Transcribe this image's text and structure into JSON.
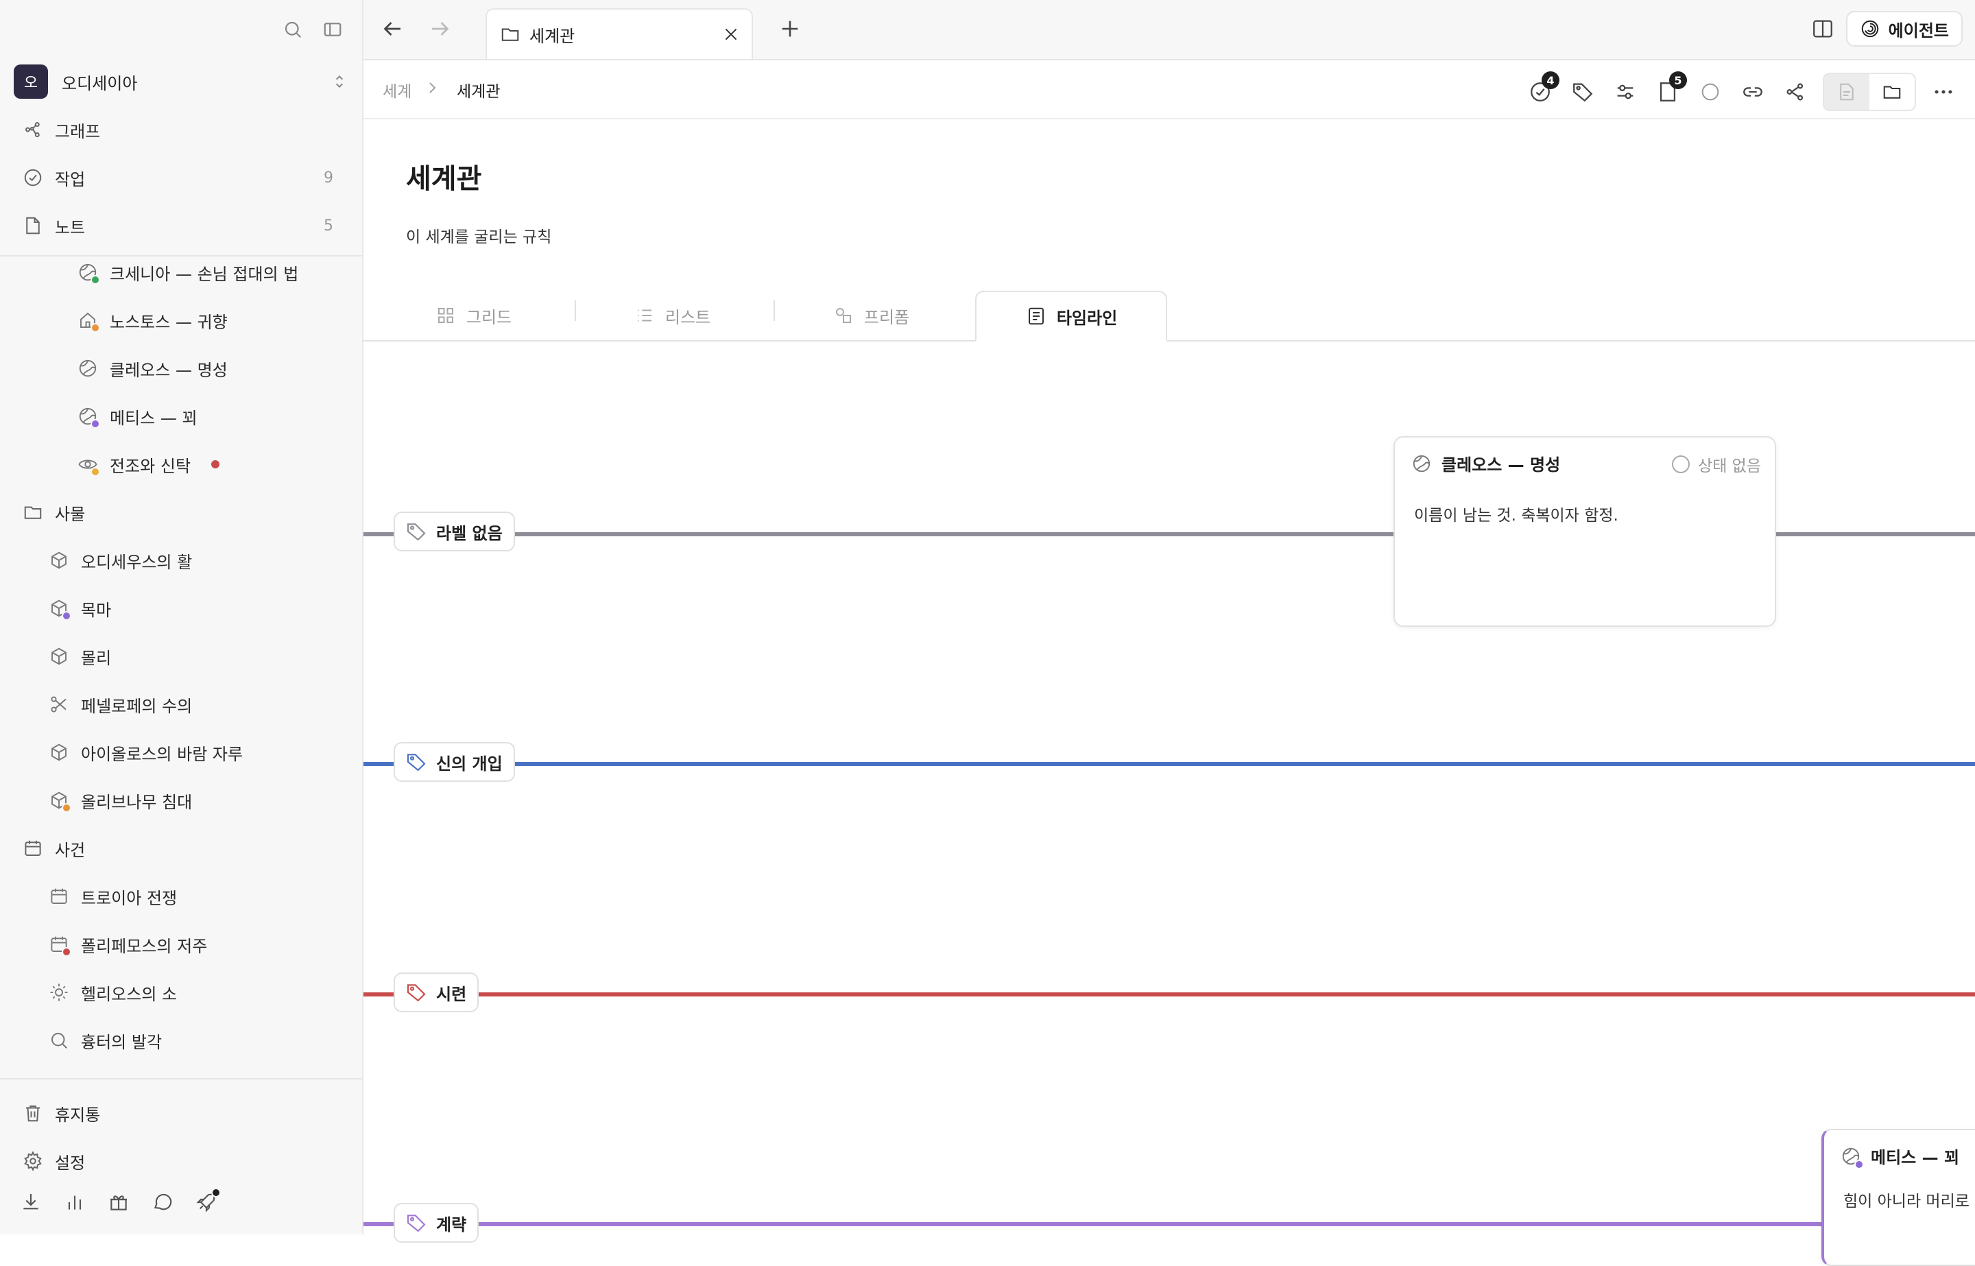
{
  "workspace": {
    "avatar_letter": "오",
    "name": "오디세이아"
  },
  "sidebar": {
    "top": [
      {
        "label": "그래프",
        "count": ""
      },
      {
        "label": "작업",
        "count": "9"
      },
      {
        "label": "노트",
        "count": "5"
      }
    ],
    "notes": [
      {
        "label": "크세니아 — 손님 접대의 법"
      },
      {
        "label": "노스토스 — 귀향"
      },
      {
        "label": "클레오스 — 명성"
      },
      {
        "label": "메티스 — 꾀"
      },
      {
        "label": "전조와 신탁"
      }
    ],
    "folder_things": {
      "label": "사물"
    },
    "things": [
      {
        "label": "오디세우스의 활"
      },
      {
        "label": "목마"
      },
      {
        "label": "몰리"
      },
      {
        "label": "페넬로페의 수의"
      },
      {
        "label": "아이올로스의 바람 자루"
      },
      {
        "label": "올리브나무 침대"
      }
    ],
    "folder_events": {
      "label": "사건"
    },
    "events": [
      {
        "label": "트로이아 전쟁"
      },
      {
        "label": "폴리페모스의 저주"
      },
      {
        "label": "헬리오스의 소"
      },
      {
        "label": "흉터의 발각"
      }
    ],
    "bottom": [
      {
        "label": "휴지통"
      },
      {
        "label": "설정"
      }
    ]
  },
  "tabbar": {
    "tab_label": "세계관",
    "agent_label": "에이전트"
  },
  "breadcrumb": {
    "parent": "세계",
    "current": "세계관"
  },
  "toolbar": {
    "tasks_badge": "4",
    "pages_badge": "5"
  },
  "page": {
    "title": "세계관",
    "description": "이 세계를 굴리는 규칙"
  },
  "view_tabs": [
    {
      "label": "그리드",
      "active": false
    },
    {
      "label": "리스트",
      "active": false
    },
    {
      "label": "프리폼",
      "active": false
    },
    {
      "label": "타임라인",
      "active": true
    }
  ],
  "lanes": [
    {
      "label": "라벨 없음",
      "color": "#8e8c96"
    },
    {
      "label": "신의 개입",
      "color": "#4a72c4"
    },
    {
      "label": "시련",
      "color": "#c94a4a"
    },
    {
      "label": "계략",
      "color": "#a07ad4"
    }
  ],
  "cards": [
    {
      "title": "클레오스 — 명성",
      "status": "상태 없음",
      "body": "이름이 남는 것. 축복이자 함정."
    },
    {
      "title": "메티스 — 꾀",
      "body": "힘이 아니라 머리로"
    }
  ],
  "colors": {
    "accent_dark": "#2f2a44",
    "dot_green": "#3aa55a",
    "dot_orange": "#e8943a",
    "dot_purple": "#8e6ad8",
    "dot_red": "#c94a4a"
  }
}
